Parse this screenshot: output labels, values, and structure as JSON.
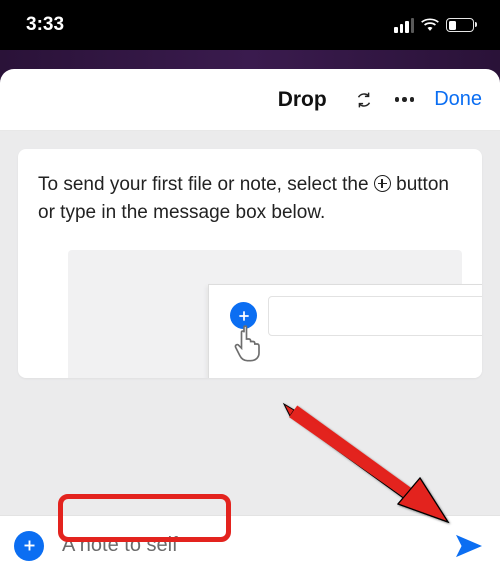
{
  "statusbar": {
    "time": "3:33"
  },
  "header": {
    "title": "Drop",
    "done_label": "Done"
  },
  "card": {
    "text_before_icon": "To send your first file or note, select the ",
    "text_after_icon": " button or type in the message box below."
  },
  "composer": {
    "placeholder": "A note to self"
  },
  "colors": {
    "accent": "#0b6ef2",
    "annotation": "#e3231e"
  }
}
